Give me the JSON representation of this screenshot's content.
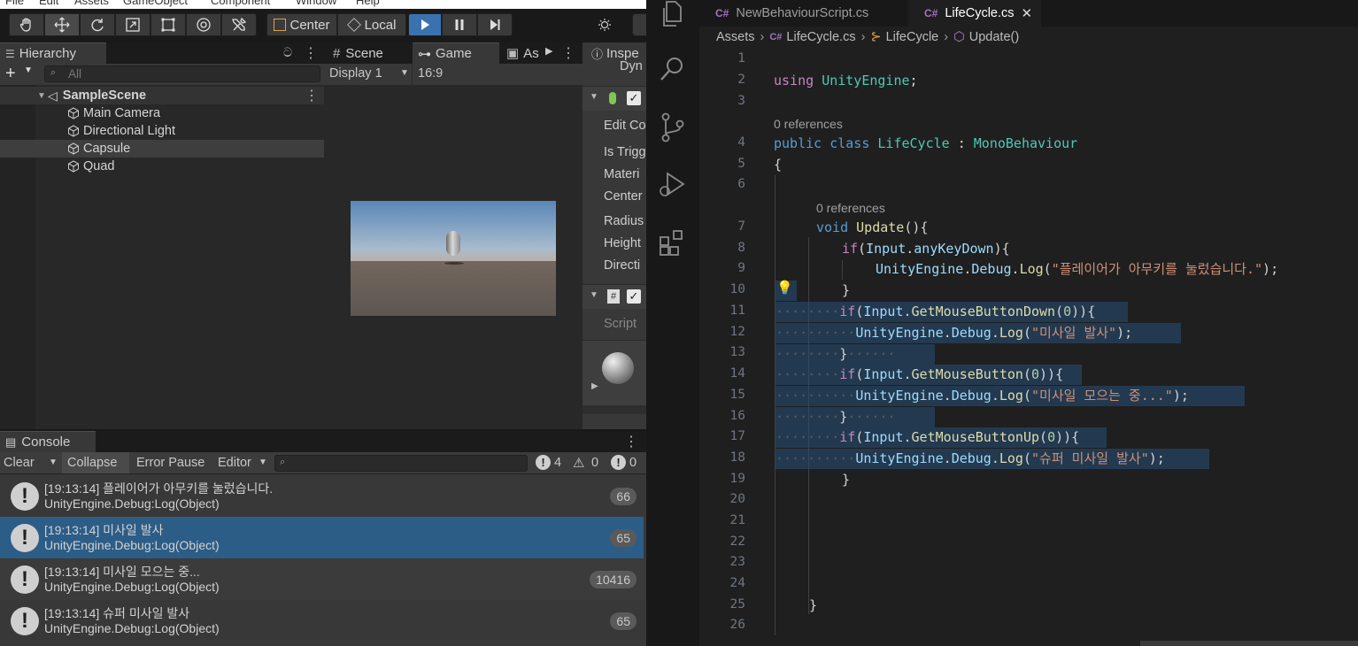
{
  "unity": {
    "menu": [
      "File",
      "Edit",
      "Assets",
      "GameObject",
      "Component",
      "Window",
      "Help"
    ],
    "toolbar": {
      "pivot_label": "Center",
      "space_label": "Local"
    },
    "hierarchy": {
      "tab_label": "Hierarchy",
      "add_label": "+",
      "search_placeholder": "All",
      "scene_name": "SampleScene",
      "items": [
        {
          "label": "Main Camera"
        },
        {
          "label": "Directional Light"
        },
        {
          "label": "Capsule",
          "selected": true
        },
        {
          "label": "Quad"
        }
      ]
    },
    "game": {
      "tabs": [
        "Scene",
        "Game",
        "As"
      ],
      "display": "Display 1",
      "aspect": "16:9"
    },
    "inspector": {
      "tab_label": "Inspe",
      "subtitle": "Dyn",
      "fields": [
        "Edit Co",
        "Is Trigg",
        "Materi",
        "Center",
        "Radius",
        "Height",
        "Directi"
      ],
      "script_label": "Script"
    },
    "console": {
      "tab_label": "Console",
      "clear": "Clear",
      "collapse": "Collapse",
      "error_pause": "Error Pause",
      "editor": "Editor",
      "counts": {
        "info": "4",
        "warn": "0",
        "error": "0"
      },
      "entries": [
        {
          "line1": "[19:13:14] 플레이어가 아무키를 눌렀습니다.",
          "line2": "UnityEngine.Debug:Log(Object)",
          "count": "66",
          "selected": false
        },
        {
          "line1": "[19:13:14] 미사일 발사",
          "line2": "UnityEngine.Debug:Log(Object)",
          "count": "65",
          "selected": true
        },
        {
          "line1": "[19:13:14] 미사일 모으는 중...",
          "line2": "UnityEngine.Debug:Log(Object)",
          "count": "10416",
          "selected": false
        },
        {
          "line1": "[19:13:14] 슈퍼 미사일 발사",
          "line2": "UnityEngine.Debug:Log(Object)",
          "count": "65",
          "selected": false
        }
      ]
    }
  },
  "vscode": {
    "tabs": [
      {
        "label": "NewBehaviourScript.cs",
        "active": false
      },
      {
        "label": "LifeCycle.cs",
        "active": true,
        "close": "✕"
      }
    ],
    "breadcrumb": [
      "Assets",
      "LifeCycle.cs",
      "LifeCycle",
      "Update()"
    ],
    "references_label": "0 references",
    "line_numbers": [
      "1",
      "2",
      "3",
      "4",
      "5",
      "6",
      "7",
      "8",
      "9",
      "10",
      "11",
      "12",
      "13",
      "14",
      "15",
      "16",
      "17",
      "18",
      "19",
      "20",
      "21",
      "22",
      "23",
      "24",
      "25",
      "26"
    ],
    "code": {
      "l2_kw": "using",
      "l2_ns": "UnityEngine",
      "l2_end": ";",
      "l4_kw1": "public",
      "l4_kw2": "class",
      "l4_name": "LifeCycle",
      "l4_colon": " : ",
      "l4_base": "MonoBehaviour",
      "l5": "{",
      "l7_kw": "void",
      "l7_fn": "Update",
      "l7_end": "(){",
      "l8_if": "if",
      "l8_a": "(",
      "l8_cls": "Input",
      "l8_dot": ".",
      "l8_prop": "anyKeyDown",
      "l8_end": "){",
      "l9_ns": "UnityEngine",
      "l9_dot1": ".",
      "l9_cls": "Debug",
      "l9_dot2": ".",
      "l9_fn": "Log",
      "l9_op": "(",
      "l9_str": "\"플레이어가 아무키를 눌렀습니다.\"",
      "l9_end": ");",
      "l10": "}",
      "l11_if": "if",
      "l11_cls": "Input",
      "l11_fn": "GetMouseButtonDown",
      "l11_num": "0",
      "l11_end": ")){",
      "l12_ns": "UnityEngine",
      "l12_cls": "Debug",
      "l12_fn": "Log",
      "l12_str": "\"미사일 발사\"",
      "l12_end": ");",
      "l13": "}",
      "l14_if": "if",
      "l14_cls": "Input",
      "l14_fn": "GetMouseButton",
      "l14_num": "0",
      "l14_end": ")){",
      "l15_ns": "UnityEngine",
      "l15_cls": "Debug",
      "l15_fn": "Log",
      "l15_str": "\"미사일 모으는 중...\"",
      "l15_end": ");",
      "l16": "}",
      "l17_if": "if",
      "l17_cls": "Input",
      "l17_fn": "GetMouseButtonUp",
      "l17_num": "0",
      "l17_end": ")){",
      "l18_ns": "UnityEngine",
      "l18_cls": "Debug",
      "l18_fn": "Log",
      "l18_str": "\"슈퍼 미사일 발사\"",
      "l18_end": ");",
      "l19": "}",
      "l25": "}"
    }
  },
  "colors": {
    "keyword": "#569cd6",
    "type": "#4ec9b0",
    "function": "#dcdcaa",
    "string": "#ce9178",
    "number": "#b5cea8",
    "control": "#c586c0",
    "unity_selection": "#2c5d87",
    "play_active": "#3a72b0"
  },
  "icons": [
    "hand-icon",
    "move-icon",
    "rotate-icon",
    "scale-icon",
    "rect-icon",
    "transform-icon",
    "custom-tool-icon",
    "play-icon",
    "pause-icon",
    "step-icon",
    "explorer-icon",
    "search-icon",
    "source-control-icon",
    "run-debug-icon",
    "extensions-icon",
    "lightbulb-icon",
    "info-icon",
    "warning-icon",
    "error-icon"
  ]
}
